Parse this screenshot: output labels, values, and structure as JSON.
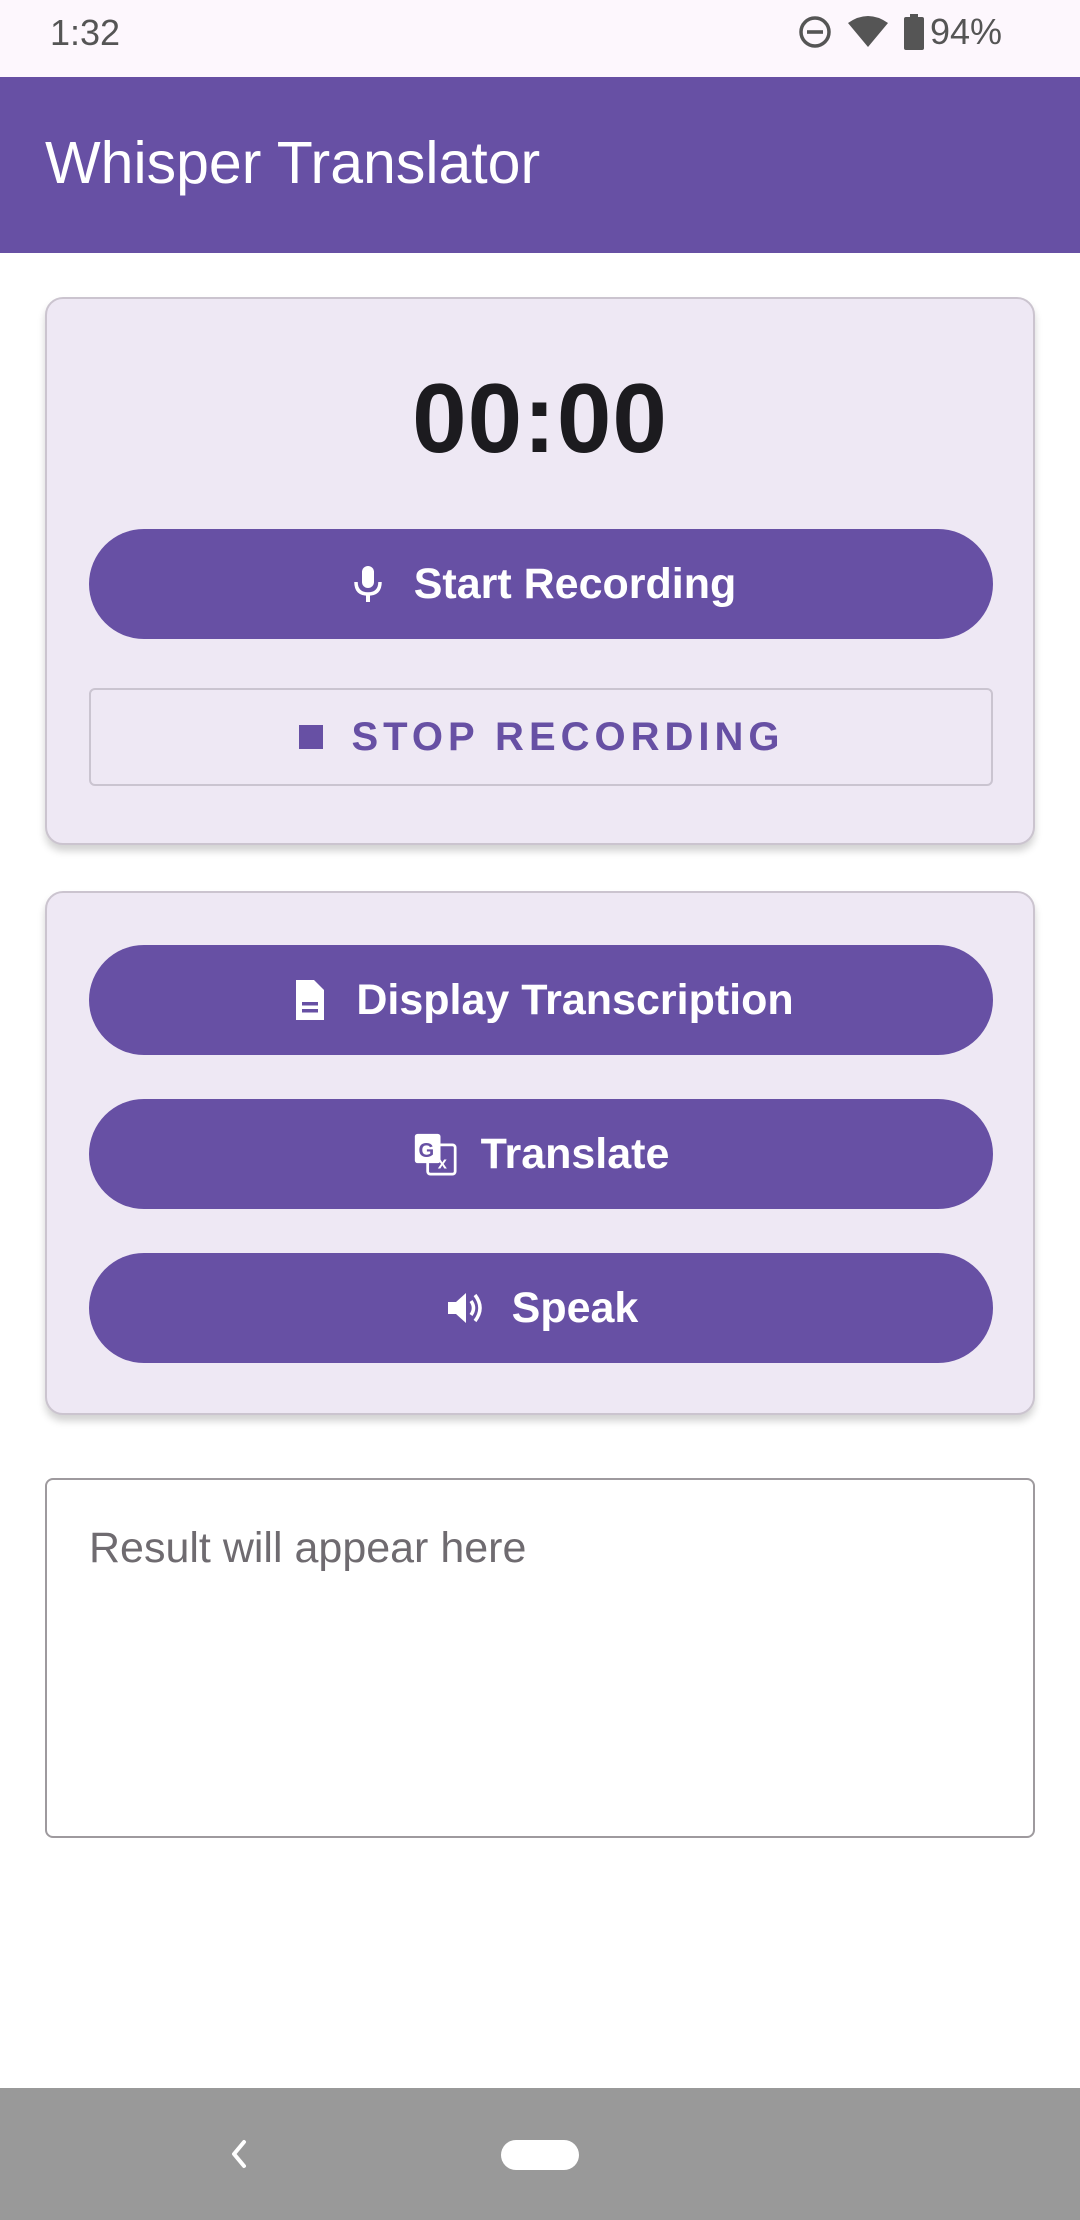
{
  "status_bar": {
    "time": "1:32",
    "battery": "94%",
    "icons": [
      "do-not-disturb-icon",
      "wifi-icon",
      "battery-icon"
    ]
  },
  "app_bar": {
    "title": "Whisper Translator"
  },
  "recorder": {
    "timer": "00:00",
    "start_label": "Start Recording",
    "start_icon": "mic-icon",
    "stop_label": "STOP RECORDING",
    "stop_icon": "stop-icon"
  },
  "actions": {
    "display_label": "Display Transcription",
    "display_icon": "document-icon",
    "translate_label": "Translate",
    "translate_icon": "translate-icon",
    "speak_label": "Speak",
    "speak_icon": "speaker-icon"
  },
  "result": {
    "placeholder": "Result will appear here"
  },
  "colors": {
    "primary": "#6750a4",
    "card_bg": "#eee8f4",
    "status_bg": "#fdf7fd",
    "nav_bg": "#999999"
  }
}
